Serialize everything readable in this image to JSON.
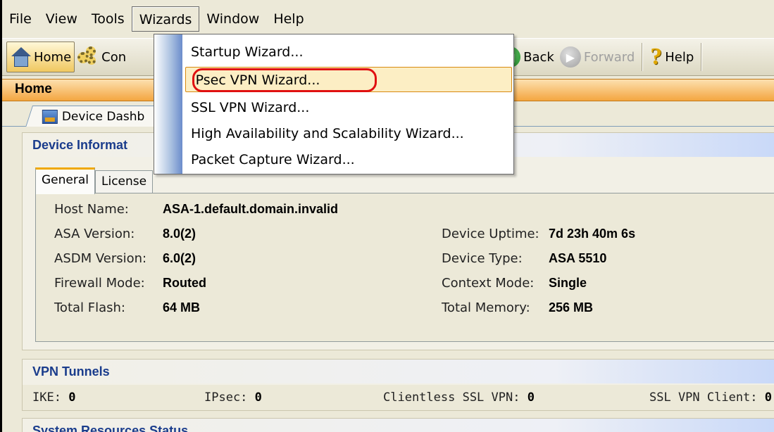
{
  "menubar": {
    "items": [
      "File",
      "View",
      "Tools",
      "Wizards",
      "Window",
      "Help"
    ],
    "open_menu": "Wizards"
  },
  "toolbar": {
    "home_label": "Home",
    "config_label": "Con",
    "back_label": "Back",
    "forward_label": "Forward",
    "help_label": "Help"
  },
  "wizards_menu": {
    "items": [
      "Startup Wizard...",
      "IPsec VPN Wizard...",
      "SSL VPN Wizard...",
      "High Availability and Scalability Wizard...",
      "Packet Capture Wizard..."
    ],
    "highlighted": "IPsec VPN Wizard..."
  },
  "home_header": {
    "title": "Home"
  },
  "dashboard_tab": {
    "label": "Device Dashb"
  },
  "device_info": {
    "title": "Device Informat",
    "tabs": [
      "General",
      "License"
    ],
    "left": [
      {
        "key": "Host Name:",
        "value": "ASA-1.default.domain.invalid"
      },
      {
        "key": "ASA Version:",
        "value": "8.0(2)"
      },
      {
        "key": "ASDM Version:",
        "value": "6.0(2)"
      },
      {
        "key": "Firewall Mode:",
        "value": "Routed"
      },
      {
        "key": "Total Flash:",
        "value": "64 MB"
      }
    ],
    "right": [
      {
        "key": "Device Uptime:",
        "value": "7d 23h 40m 6s"
      },
      {
        "key": "Device Type:",
        "value": "ASA 5510"
      },
      {
        "key": "Context Mode:",
        "value": "Single"
      },
      {
        "key": "Total Memory:",
        "value": "256 MB"
      }
    ]
  },
  "vpn_tunnels": {
    "title": "VPN Tunnels",
    "items": [
      {
        "key": "IKE:",
        "value": "0"
      },
      {
        "key": "IPsec:",
        "value": "0"
      },
      {
        "key": "Clientless SSL VPN:",
        "value": "0"
      },
      {
        "key": "SSL VPN Client:",
        "value": "0"
      }
    ]
  },
  "system_resources": {
    "title": "System Resources Status"
  },
  "colors": {
    "accent_orange": "#f4a640",
    "section_title_blue": "#1a3c8c",
    "highlight_ring": "#e01010"
  }
}
